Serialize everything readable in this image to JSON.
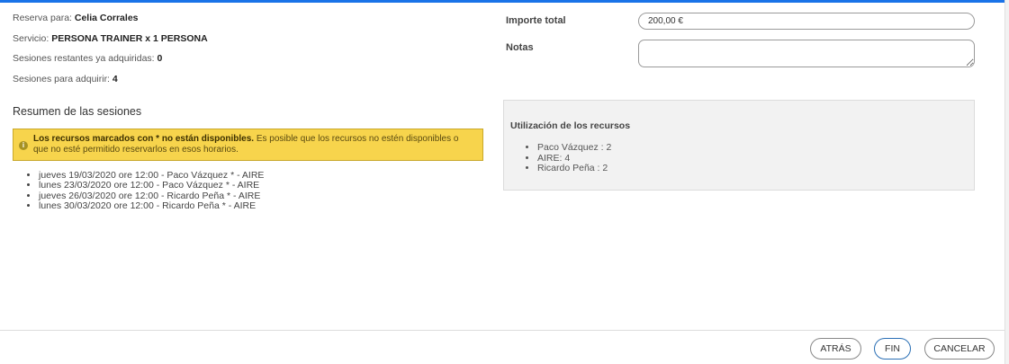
{
  "booking": {
    "reserva_label": "Reserva para:",
    "reserva_value": "Celia Corrales",
    "servicio_label": "Servicio:",
    "servicio_value": "PERSONA TRAINER x 1 PERSONA",
    "restantes_label": "Sesiones restantes ya adquiridas:",
    "restantes_value": "0",
    "adquirir_label": "Sesiones para adquirir:",
    "adquirir_value": "4"
  },
  "summary": {
    "title": "Resumen de las sesiones",
    "warning_bold": "Los recursos marcados con * no están disponibles.",
    "warning_text": "Es posible que los recursos no estén disponibles o que no esté permitido reservarlos en esos horarios.",
    "sessions": [
      "jueves 19/03/2020 ore 12:00 - Paco Vázquez * - AIRE",
      "lunes 23/03/2020 ore 12:00 - Paco Vázquez * - AIRE",
      "jueves 26/03/2020 ore 12:00 - Ricardo Peña * - AIRE",
      "lunes 30/03/2020 ore 12:00 - Ricardo Peña * - AIRE"
    ]
  },
  "form": {
    "total_label": "Importe total",
    "total_value": "200,00 €",
    "notes_label": "Notas",
    "notes_value": ""
  },
  "resources": {
    "title": "Utilización de los recursos",
    "items": [
      "Paco Vázquez : 2",
      "AIRE: 4",
      "Ricardo Peña : 2"
    ]
  },
  "buttons": {
    "back": "ATRÁS",
    "finish": "FIN",
    "cancel": "CANCELAR"
  },
  "colors": {
    "accent": "#1a73e8",
    "warning": "#f7d44c",
    "primary_button": "#2a6fb5"
  }
}
